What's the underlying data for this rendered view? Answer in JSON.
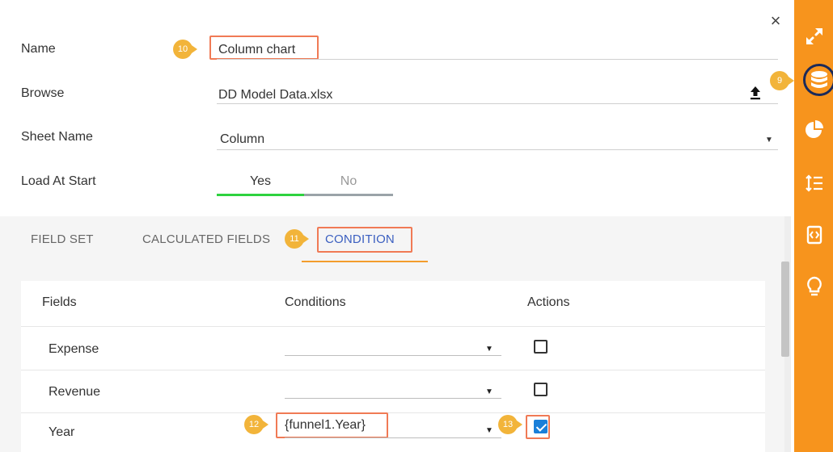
{
  "dialog": {
    "close_glyph": "×"
  },
  "form": {
    "name_label": "Name",
    "name_value": "Column chart",
    "browse_label": "Browse",
    "browse_value": "DD Model Data.xlsx",
    "sheet_label": "Sheet Name",
    "sheet_value": "Column",
    "load_label": "Load At Start",
    "load_yes": "Yes",
    "load_no": "No",
    "load_selected": "Yes"
  },
  "callouts": {
    "c9": "9",
    "c10": "10",
    "c11": "11",
    "c12": "12",
    "c13": "13"
  },
  "tabs": [
    {
      "label": "FIELD SET",
      "active": false
    },
    {
      "label": "CALCULATED FIELDS",
      "active": false
    },
    {
      "label": "CONDITION",
      "active": true
    }
  ],
  "table": {
    "headers": [
      "Fields",
      "Conditions",
      "Actions"
    ],
    "rows": [
      {
        "field": "Expense",
        "condition": "",
        "checked": false
      },
      {
        "field": "Revenue",
        "condition": "",
        "checked": false
      },
      {
        "field": "Year",
        "condition": "{funnel1.Year}",
        "checked": true
      }
    ]
  },
  "sidebar": {
    "items": [
      "expand-icon",
      "database-icon",
      "pie-chart-icon",
      "sort-list-icon",
      "code-frame-icon",
      "lightbulb-icon"
    ],
    "active": "database-icon",
    "color": "#f7941d"
  },
  "colors": {
    "highlight": "#f07a55",
    "callout": "#f2b43a",
    "active_tab": "#3b5fc0",
    "tab_underline": "#f39c2c",
    "toggle_yes": "#2ed23f",
    "checkbox": "#1a7fd9"
  }
}
